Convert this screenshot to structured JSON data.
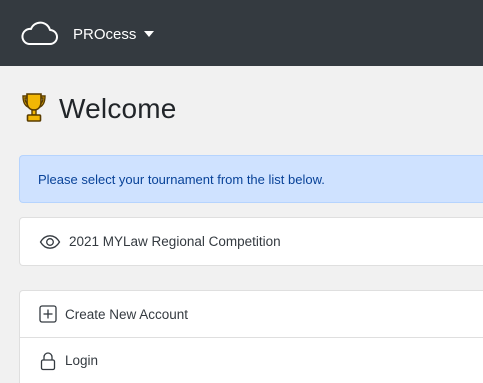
{
  "navbar": {
    "brand_label": "PROcess",
    "brand_icon": "cloud-icon",
    "dropdown_icon": "caret-down-icon"
  },
  "page": {
    "title": "Welcome",
    "title_icon": "trophy-icon"
  },
  "alert": {
    "text": "Please select your tournament from the list below."
  },
  "tournaments": [
    {
      "label": "2021 MYLaw Regional Competition",
      "icon": "eye-icon"
    }
  ],
  "account_actions": {
    "create": {
      "label": "Create New Account",
      "icon": "plus-square-icon"
    },
    "login": {
      "label": "Login",
      "icon": "lock-icon"
    }
  },
  "colors": {
    "navbar_bg": "#343a40",
    "page_bg": "#f1f1f1",
    "alert_bg": "#cfe2ff",
    "alert_text": "#084298",
    "trophy_gold": "#f2b705"
  }
}
